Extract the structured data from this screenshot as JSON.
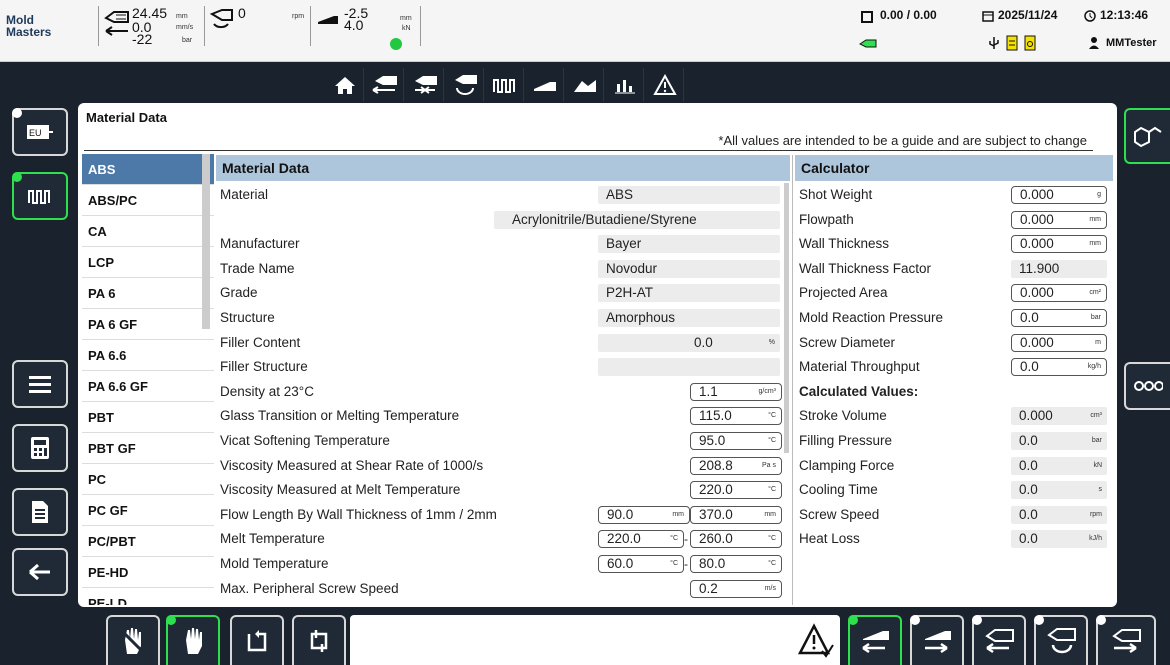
{
  "topbar": {
    "logo_line1": "Mold",
    "logo_line2": "Masters",
    "position": "24.45",
    "position_unit": "mm",
    "speed": "0.0",
    "speed_unit": "mm/s",
    "pressure": "-22",
    "pressure_unit": "bar",
    "screw_rpm": "0",
    "screw_rpm_unit": "rpm",
    "clamp_pos": "-2.5",
    "clamp_pos_unit": "mm",
    "clamp_force": "4.0",
    "clamp_force_unit": "kN",
    "counter": "0.00 / 0.00",
    "date": "2025/11/24",
    "time": "12:13:46",
    "user": "MMTester"
  },
  "nav": [
    "home-icon",
    "injection-icon",
    "hold-icon",
    "screw-recovery-icon",
    "temperature-zones-icon",
    "clamp-icon",
    "profile-graph-icon",
    "statistics-icon",
    "alarms-icon"
  ],
  "panel": {
    "title": "Material Data",
    "note": "*All values are intended to be a guide and are subject to change"
  },
  "materials": [
    "ABS",
    "ABS/PC",
    "CA",
    "LCP",
    "PA 6",
    "PA 6 GF",
    "PA 6.6",
    "PA 6.6 GF",
    "PBT",
    "PBT GF",
    "PC",
    "PC GF",
    "PC/PBT",
    "PE-HD",
    "PE-LD"
  ],
  "selected_material": "ABS",
  "material_data": {
    "header": "Material Data",
    "material_label": "Material",
    "material_value": "ABS",
    "material_fullname": "Acrylonitrile/Butadiene/Styrene",
    "manufacturer_label": "Manufacturer",
    "manufacturer_value": "Bayer",
    "trade_name_label": "Trade Name",
    "trade_name_value": "Novodur",
    "grade_label": "Grade",
    "grade_value": "P2H-AT",
    "structure_label": "Structure",
    "structure_value": "Amorphous",
    "filler_content_label": "Filler Content",
    "filler_content_value": "0.0",
    "filler_content_unit": "%",
    "filler_structure_label": "Filler Structure",
    "filler_structure_value": "",
    "density_label": "Density at 23°C",
    "density_value": "1.1",
    "density_unit": "g/cm³",
    "glass_label": "Glass Transition or Melting Temperature",
    "glass_value": "115.0",
    "glass_unit": "°C",
    "vicat_label": "Vicat Softening Temperature",
    "vicat_value": "95.0",
    "vicat_unit": "°C",
    "visc_shear_label": "Viscosity Measured at Shear Rate of 1000/s",
    "visc_shear_value": "208.8",
    "visc_shear_unit": "Pa s",
    "visc_melt_label": "Viscosity Measured at Melt Temperature",
    "visc_melt_value": "220.0",
    "visc_melt_unit": "°C",
    "flow_len_label": "Flow Length By Wall Thickness of 1mm / 2mm",
    "flow_len_1": "90.0",
    "flow_len_2": "370.0",
    "flow_len_unit": "mm",
    "melt_temp_label": "Melt Temperature",
    "melt_temp_min": "220.0",
    "melt_temp_max": "260.0",
    "melt_temp_unit": "°C",
    "mold_temp_label": "Mold Temperature",
    "mold_temp_min": "60.0",
    "mold_temp_max": "80.0",
    "mold_temp_unit": "°C",
    "screw_speed_label": "Max. Peripheral Screw Speed",
    "screw_speed_value": "0.2",
    "screw_speed_unit": "m/s"
  },
  "calculator": {
    "header": "Calculator",
    "inputs": [
      {
        "label": "Shot Weight",
        "value": "0.000",
        "unit": "g"
      },
      {
        "label": "Flowpath",
        "value": "0.000",
        "unit": "mm"
      },
      {
        "label": "Wall Thickness",
        "value": "0.000",
        "unit": "mm"
      },
      {
        "label": "Wall Thickness Factor",
        "value": "11.900",
        "unit": ""
      },
      {
        "label": "Projected Area",
        "value": "0.000",
        "unit": "cm²"
      },
      {
        "label": "Mold Reaction Pressure",
        "value": "0.0",
        "unit": "bar"
      },
      {
        "label": "Screw Diameter",
        "value": "0.000",
        "unit": "m"
      },
      {
        "label": "Material Throughput",
        "value": "0.0",
        "unit": "kg/h"
      }
    ],
    "calculated_header": "Calculated Values:",
    "outputs": [
      {
        "label": "Stroke Volume",
        "value": "0.000",
        "unit": "cm³"
      },
      {
        "label": "Filling Pressure",
        "value": "0.0",
        "unit": "bar"
      },
      {
        "label": "Clamping Force",
        "value": "0.0",
        "unit": "kN"
      },
      {
        "label": "Cooling Time",
        "value": "0.0",
        "unit": "s"
      },
      {
        "label": "Screw Speed",
        "value": "0.0",
        "unit": "rpm"
      },
      {
        "label": "Heat Loss",
        "value": "0.0",
        "unit": "kJ/h"
      }
    ]
  },
  "colors": {
    "accent_green": "#2ee04d",
    "header_blue": "#aec6dc",
    "selected_blue": "#4d79a8",
    "background": "#1a232d"
  }
}
